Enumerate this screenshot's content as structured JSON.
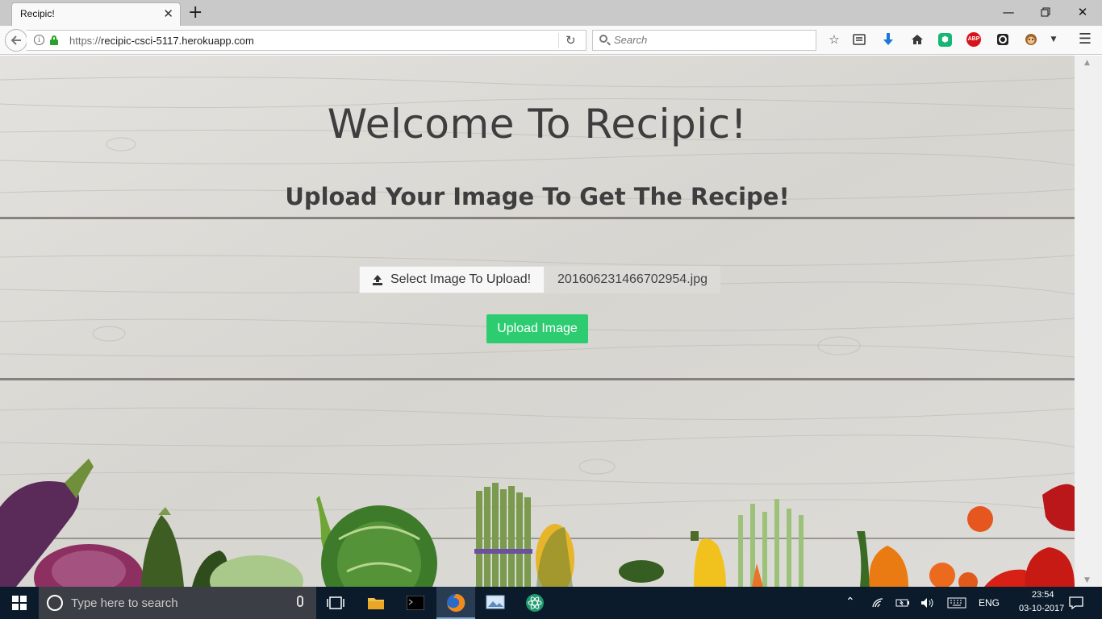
{
  "browser": {
    "tab_title": "Recipic!",
    "url_scheme": "https://",
    "url_host": "recipic-csci-5117.herokuapp.com",
    "search_placeholder": "Search",
    "abp_label": "ABP"
  },
  "page": {
    "title": "Welcome To Recipic!",
    "subtitle": "Upload Your Image To Get The Recipe!",
    "file_button_label": "Select Image To Upload!",
    "file_name": "201606231466702954.jpg",
    "upload_button_label": "Upload Image",
    "upload_button_color": "#2ecc71"
  },
  "taskbar": {
    "search_placeholder": "Type here to search",
    "language": "ENG",
    "time": "23:54",
    "date": "03-10-2017"
  }
}
